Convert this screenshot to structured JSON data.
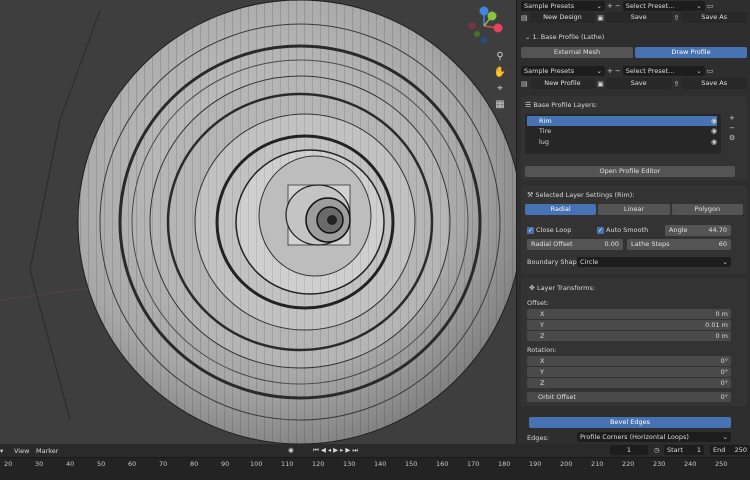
{
  "presets_top": {
    "preset_select": "Sample Presets",
    "select_preset": "Select Preset...",
    "new_button": "New Design",
    "save_button": "Save",
    "save_as_button": "Save As"
  },
  "base_profile": {
    "header": "1. Base Profile (Lathe)",
    "tab_external": "External Mesh",
    "tab_draw": "Draw Profile"
  },
  "presets_profile": {
    "preset_select": "Sample Presets",
    "select_preset": "Select Preset...",
    "new_button": "New Profile",
    "save_button": "Save",
    "save_as_button": "Save As"
  },
  "layers": {
    "header": "Base Profile Layers:",
    "items": [
      {
        "label": "Rim"
      },
      {
        "label": "Tire"
      },
      {
        "label": "lug"
      }
    ],
    "open_editor": "Open Profile Editor"
  },
  "selected_layer": {
    "header": "Selected Layer Settings (Rim):",
    "tabs": [
      "Radial",
      "Linear",
      "Polygon"
    ],
    "close_loop": "Close Loop",
    "auto_smooth": "Auto Smooth",
    "angle_label": "Angle",
    "angle_value": "44.70",
    "radial_offset_label": "Radial Offset",
    "radial_offset_value": "0.00",
    "lathe_steps_label": "Lathe Steps",
    "lathe_steps_value": "60",
    "boundary_label": "Boundary Shape:",
    "boundary_value": "Circle"
  },
  "transforms": {
    "header": "Layer Transforms:",
    "offset_label": "Offset:",
    "offset": [
      {
        "axis": "X",
        "value": "0 m"
      },
      {
        "axis": "Y",
        "value": "0.01 m"
      },
      {
        "axis": "Z",
        "value": "0 m"
      }
    ],
    "rotation_label": "Rotation:",
    "rotation": [
      {
        "axis": "X",
        "value": "0°"
      },
      {
        "axis": "Y",
        "value": "0°"
      },
      {
        "axis": "Z",
        "value": "0°"
      }
    ],
    "orbit_label": "Orbit Offset",
    "orbit_value": "0°"
  },
  "bevel": {
    "button": "Bevel Edges",
    "edges_label": "Edges:",
    "edges_value": "Profile Corners (Horizontal Loops)"
  },
  "gizmo": {
    "x": "X",
    "y": "Y",
    "z": "Z",
    "x_color": "#e8445a",
    "y_color": "#8ac53b",
    "z_color": "#3f86e0"
  },
  "timeline": {
    "menu_view": "View",
    "menu_marker": "Marker",
    "current_frame": "1",
    "start_label": "Start",
    "start_value": "1",
    "end_label": "End",
    "end_value": "250",
    "ticks": [
      "20",
      "30",
      "40",
      "50",
      "60",
      "70",
      "80",
      "90",
      "100",
      "110",
      "120",
      "130",
      "140",
      "150",
      "160",
      "170",
      "180",
      "190",
      "200",
      "210",
      "220",
      "230",
      "240",
      "250"
    ]
  }
}
